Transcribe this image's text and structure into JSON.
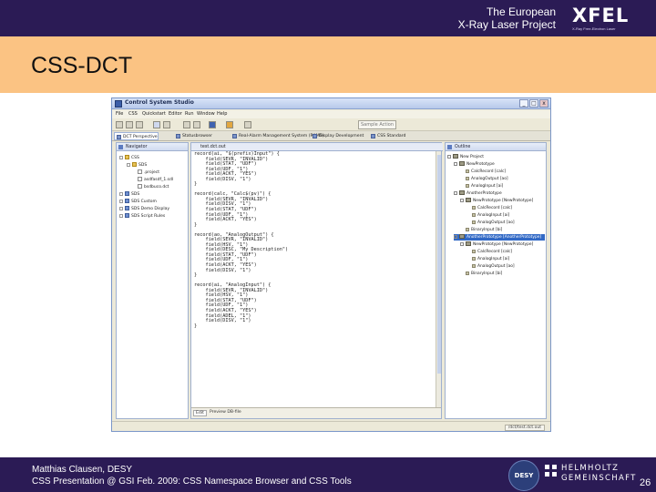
{
  "slide": {
    "institution_line1": "The European",
    "institution_line2": "X-Ray Laser Project",
    "logo": "XFEL",
    "logo_subtitle": "X-Ray Free-Electron Laser",
    "title": "CSS-DCT",
    "footer_line1": "Matthias Clausen, DESY",
    "footer_line2": "CSS Presentation @ GSI Feb. 2009: CSS Namespace Browser and CSS Tools",
    "desy_logo": "DESY",
    "helmholtz_line1": "HELMHOLTZ",
    "helmholtz_line2": "GEMEINSCHAFT",
    "page_number": "26",
    "colors": {
      "header_bg": "#2b1b55",
      "title_band": "#fbc383",
      "footer_bg": "#2b1b55"
    }
  },
  "app": {
    "window_title": "Control System Studio",
    "window_buttons": [
      "_",
      "□",
      "x"
    ],
    "menus": [
      "File",
      "CSS",
      "Quickstart",
      "Editor",
      "Run",
      "Window",
      "Help"
    ],
    "toolbar_combo": "Sample Action",
    "perspective_tabs": [
      {
        "label": "DCT Perspective",
        "active": true
      },
      {
        "label": "Statusbrowser",
        "active": false
      },
      {
        "label": "Real-Alarm Management System (RAMS)",
        "active": false
      },
      {
        "label": "Display Development",
        "active": false
      },
      {
        "label": "CSS Standard",
        "active": false
      }
    ],
    "navigator": {
      "title": "Navigator",
      "items": [
        {
          "label": "CSS",
          "indent": 0,
          "icon": "folder-icon"
        },
        {
          "label": "SDS",
          "indent": 1,
          "icon": "folder-icon"
        },
        {
          "label": ".project",
          "indent": 2,
          "icon": "file-icon"
        },
        {
          "label": "asdfasdf_1.sdl",
          "indent": 2,
          "icon": "file-icon"
        },
        {
          "label": "bsdbuco.dct",
          "indent": 2,
          "icon": "file-icon"
        },
        {
          "label": "SDS",
          "indent": 0,
          "icon": "project-icon"
        },
        {
          "label": "SDS Custom",
          "indent": 0,
          "icon": "project-icon"
        },
        {
          "label": "SDS Demo Display",
          "indent": 0,
          "icon": "project-icon"
        },
        {
          "label": "SDS Script Rules",
          "indent": 0,
          "icon": "project-icon"
        }
      ]
    },
    "editor": {
      "tab_label": "test.dct.out",
      "code": "record(ai, \"$(prefix)Input\") {\n    field(SEVR, \"INVALID\")\n    field(STAT, \"UDF\")\n    field(UDF, \"1\")\n    field(ACKT, \"YES\")\n    field(DISV, \"1\")\n}\n\nrecord(calc, \"Calc$(pv)\") {\n    field(SEVR, \"INVALID\")\n    field(DISV, \"1\")\n    field(STAT, \"UDF\")\n    field(UDF, \"1\")\n    field(ACKT, \"YES\")\n}\n\nrecord(ao, \"AnalogOutput\") {\n    field(SEVR, \"INVALID\")\n    field(HSV, \"1\")\n    field(DESC, \"My Description\")\n    field(STAT, \"UDF\")\n    field(UDF, \"1\")\n    field(ACKT, \"YES\")\n    field(DISV, \"1\")\n}\n\nrecord(ai, \"AnalogInput\") {\n    field(SEVR, \"INVALID\")\n    field(HSV, \"1\")\n    field(STAT, \"UDF\")\n    field(UDF, \"1\")\n    field(ACKT, \"YES\")\n    field(ADEL, \"1\")\n    field(DISV, \"1\")\n}",
      "bottom_tabs": [
        "Edit",
        "Preview DB-file"
      ]
    },
    "outline": {
      "title": "Outline",
      "items": [
        {
          "label": "New Project",
          "indent": 0,
          "icon": "box"
        },
        {
          "label": "NewPrototype",
          "indent": 1,
          "icon": "box"
        },
        {
          "label": "CalcRecord [calc]",
          "indent": 2,
          "icon": "leaf"
        },
        {
          "label": "AnalogOutput [ao]",
          "indent": 2,
          "icon": "leaf"
        },
        {
          "label": "AnalogInput [ai]",
          "indent": 2,
          "icon": "leaf"
        },
        {
          "label": "AnotherPrototype",
          "indent": 1,
          "icon": "box"
        },
        {
          "label": "NewPrototype [NewPrototype]",
          "indent": 2,
          "icon": "box"
        },
        {
          "label": "CalcRecord [calc]",
          "indent": 3,
          "icon": "leaf"
        },
        {
          "label": "AnalogInput [ai]",
          "indent": 3,
          "icon": "leaf"
        },
        {
          "label": "AnalogOutput [ao]",
          "indent": 3,
          "icon": "leaf"
        },
        {
          "label": "BinaryInput [bi]",
          "indent": 2,
          "icon": "leaf"
        },
        {
          "label": "AnotherPrototype [AnotherPrototype]",
          "indent": 1,
          "icon": "box",
          "selected": true
        },
        {
          "label": "NewPrototype [NewPrototype]",
          "indent": 2,
          "icon": "box"
        },
        {
          "label": "CalcRecord [calc]",
          "indent": 3,
          "icon": "leaf"
        },
        {
          "label": "AnalogInput [ai]",
          "indent": 3,
          "icon": "leaf"
        },
        {
          "label": "AnalogOutput [ao]",
          "indent": 3,
          "icon": "leaf"
        },
        {
          "label": "BinaryInput [bi]",
          "indent": 2,
          "icon": "leaf"
        }
      ]
    },
    "status_right": "/dct/test.dct.out"
  }
}
